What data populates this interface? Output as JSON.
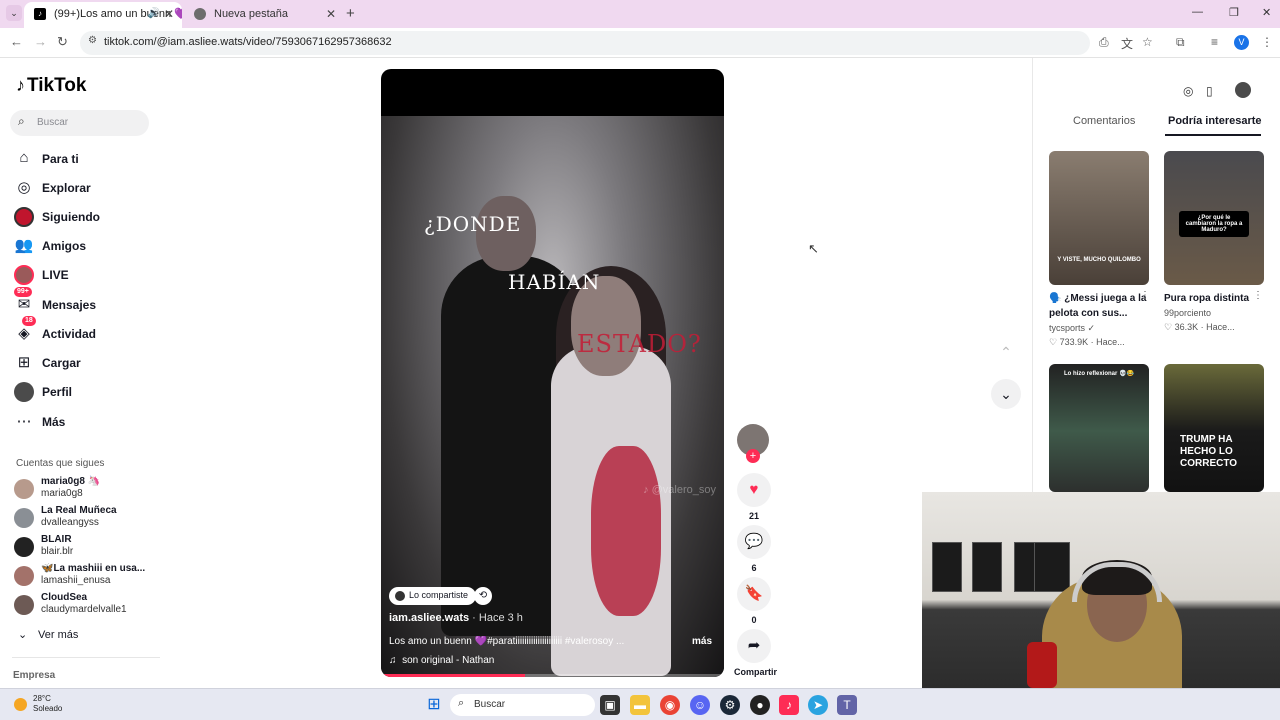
{
  "browser": {
    "tabs": [
      {
        "title": "(99+)Los amo un buenn 💜"
      },
      {
        "title": "Nueva pestaña"
      }
    ],
    "url": "tiktok.com/@iam.asliee.wats/video/7593067162957368632",
    "profile_initial": "V"
  },
  "sidebar": {
    "brand": "TikTok",
    "search_placeholder": "Buscar",
    "nav": [
      {
        "label": "Para ti",
        "icon": "home-icon"
      },
      {
        "label": "Explorar",
        "icon": "compass-icon"
      },
      {
        "label": "Siguiendo",
        "icon": "following-avatar-icon"
      },
      {
        "label": "Amigos",
        "icon": "friends-icon"
      },
      {
        "label": "LIVE",
        "icon": "live-avatar-icon"
      },
      {
        "label": "Mensajes",
        "icon": "messages-icon",
        "badge": "99+"
      },
      {
        "label": "Actividad",
        "icon": "activity-icon",
        "badge": "18"
      },
      {
        "label": "Cargar",
        "icon": "upload-icon"
      },
      {
        "label": "Perfil",
        "icon": "profile-avatar-icon"
      },
      {
        "label": "Más",
        "icon": "more-icon"
      }
    ],
    "following_title": "Cuentas que sigues",
    "following": [
      {
        "name": "maria0g8 🦄",
        "handle": "maria0g8"
      },
      {
        "name": "La Real Muñeca",
        "handle": "dvalleangyss"
      },
      {
        "name": "BLAIR",
        "handle": "blair.blr"
      },
      {
        "name": "🦋La mashiii en usa...",
        "handle": "lamashii_enusa"
      },
      {
        "name": "CloudSea",
        "handle": "claudymardelvalle1"
      }
    ],
    "see_more": "Ver más",
    "company": "Empresa"
  },
  "video": {
    "lyrics": [
      "¿DONDE",
      "HABÍAN",
      "ESTADO?"
    ],
    "watermark": "@valero_soy",
    "shared_label": "Lo compartiste",
    "author": "iam.asliee.wats",
    "time_ago": "· Hace 3 h",
    "description": "Los amo un buenn 💜#paratiiiiiiiiiiiiiiiiiiiii #valerosoy ...",
    "more": "más",
    "sound": "son original - Nathan",
    "progress": 0.42
  },
  "actions": {
    "likes": "21",
    "comments": "6",
    "saves": "0",
    "share_label": "Compartir"
  },
  "right_panel": {
    "tabs": [
      "Comentarios",
      "Podría interesarte"
    ],
    "active_tab": "Podría interesarte",
    "cards": [
      {
        "title": "🗣️ ¿Messi juega a la pelota con sus...",
        "user": "tycsports ✓",
        "stats": "♡ 733.9K · Hace...",
        "thumb_caption": "Y VISTE, MUCHO QUILOMBO"
      },
      {
        "title": "Pura ropa distinta",
        "user": "99porciento",
        "stats": "♡ 36.3K · Hace...",
        "thumb_caption": "¿Por qué le cambiaron la ropa a Maduro?"
      },
      {
        "thumb_caption": "Lo hizo reflexionar 💀😂"
      },
      {
        "thumb_caption": "TRUMP HA HECHO LO CORRECTO"
      }
    ]
  },
  "taskbar": {
    "temp": "28°C",
    "condition": "Soleado",
    "search": "Buscar"
  },
  "colors": {
    "accent": "#fe2c55",
    "tabbar": "#f0d9f0"
  }
}
